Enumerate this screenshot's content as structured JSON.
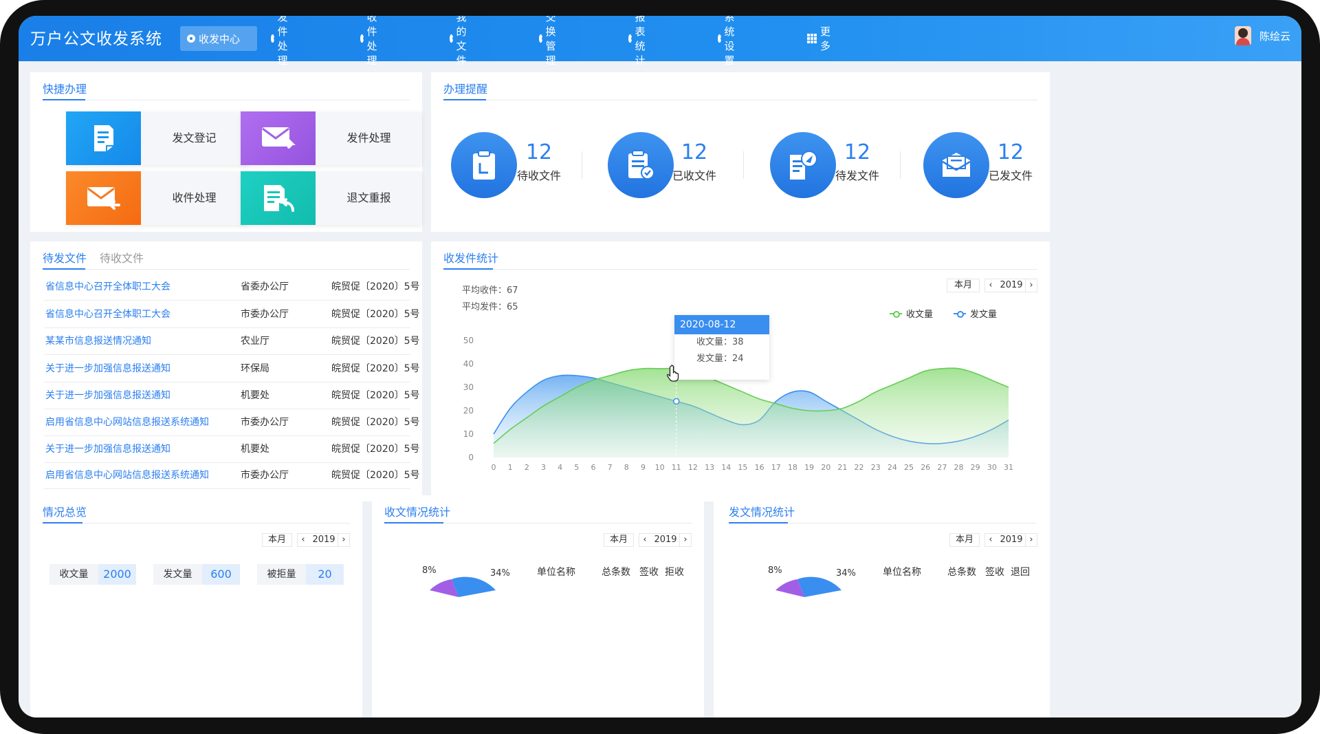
{
  "app": {
    "title": "万户公文收发系统"
  },
  "nav": {
    "items": [
      {
        "label": "收发中心"
      },
      {
        "label": "发件处理"
      },
      {
        "label": "收件处理"
      },
      {
        "label": "我的文件"
      },
      {
        "label": "交换管理"
      },
      {
        "label": "报表统计"
      },
      {
        "label": "系统设置"
      }
    ],
    "more": "更多",
    "active_index": 0
  },
  "user": {
    "name": "陈绘云"
  },
  "quick": {
    "title": "快捷办理",
    "items": [
      {
        "label": "发文登记",
        "color": "#1b96f0",
        "icon": "document-edit-icon"
      },
      {
        "label": "发件处理",
        "color": "#a25fe6",
        "icon": "mail-send-icon"
      },
      {
        "label": "收件处理",
        "color": "#f97a1d",
        "icon": "mail-receive-icon"
      },
      {
        "label": "退文重报",
        "color": "#17c5b7",
        "icon": "document-return-icon"
      }
    ]
  },
  "reminder": {
    "title": "办理提醒",
    "items": [
      {
        "count": "12",
        "label": "待收文件",
        "icon": "clipboard-icon"
      },
      {
        "count": "12",
        "label": "已收文件",
        "icon": "clipboard-check-icon"
      },
      {
        "count": "12",
        "label": "待发文件",
        "icon": "send-document-icon"
      },
      {
        "count": "12",
        "label": "已发文件",
        "icon": "envelope-icon"
      }
    ]
  },
  "files": {
    "tabs": [
      "待发文件",
      "待收文件"
    ],
    "active_tab": 0,
    "rows": [
      {
        "title": "省信息中心召开全体职工大会",
        "dept": "省委办公厅",
        "no": "皖贸促〔2020〕5号"
      },
      {
        "title": "省信息中心召开全体职工大会",
        "dept": "市委办公厅",
        "no": "皖贸促〔2020〕5号"
      },
      {
        "title": "某某市信息报送情况通知",
        "dept": "农业厅",
        "no": "皖贸促〔2020〕5号"
      },
      {
        "title": "关于进一步加强信息报送通知",
        "dept": "环保局",
        "no": "皖贸促〔2020〕5号"
      },
      {
        "title": "关于进一步加强信息报送通知",
        "dept": "机要处",
        "no": "皖贸促〔2020〕5号"
      },
      {
        "title": "启用省信息中心网站信息报送系统通知",
        "dept": "市委办公厅",
        "no": "皖贸促〔2020〕5号"
      },
      {
        "title": "关于进一步加强信息报送通知",
        "dept": "机要处",
        "no": "皖贸促〔2020〕5号"
      },
      {
        "title": "启用省信息中心网站信息报送系统通知",
        "dept": "市委办公厅",
        "no": "皖贸促〔2020〕5号"
      }
    ]
  },
  "stats": {
    "title": "收发件统计",
    "avg_recv": "平均收件：67",
    "avg_send": "平均发件：65",
    "period": "本月",
    "year": "2019",
    "prev": "‹",
    "next": "›",
    "tooltip": {
      "date": "2020-08-12",
      "recv": "收文量：38",
      "send": "发文量：24"
    }
  },
  "chart_data": {
    "type": "area",
    "x": [
      0,
      1,
      2,
      3,
      4,
      5,
      6,
      7,
      8,
      9,
      10,
      11,
      12,
      13,
      14,
      15,
      16,
      17,
      18,
      19,
      20,
      21,
      22,
      23,
      24,
      25,
      26,
      27,
      28,
      29,
      30,
      31
    ],
    "ylim": [
      0,
      50
    ],
    "yticks": [
      0,
      10,
      20,
      30,
      40,
      50
    ],
    "grid": false,
    "legend": "top-right",
    "series": [
      {
        "name": "收文量",
        "color": "#66cc55",
        "values": [
          6,
          12,
          17,
          22,
          26,
          30,
          33,
          35,
          37,
          38,
          38,
          38,
          37,
          34,
          31,
          28,
          25,
          23,
          21,
          20,
          20,
          21,
          24,
          28,
          31,
          34,
          37,
          38,
          38,
          36,
          33,
          30
        ]
      },
      {
        "name": "发文量",
        "color": "#3a8ef0",
        "values": [
          10,
          21,
          28,
          33,
          35,
          35,
          34,
          32,
          30,
          28,
          26,
          24,
          22,
          19,
          16,
          14,
          16,
          24,
          28,
          28,
          24,
          20,
          16,
          12,
          9,
          7,
          6,
          6,
          7,
          9,
          12,
          16
        ]
      }
    ]
  },
  "overview": {
    "title": "情况总览",
    "period": "本月",
    "year": "2019",
    "prev": "‹",
    "next": "›",
    "items": [
      {
        "label": "收文量",
        "value": "2000"
      },
      {
        "label": "发文量",
        "value": "600"
      },
      {
        "label": "被拒量",
        "value": "20"
      }
    ]
  },
  "recv_stats": {
    "title": "收文情况统计",
    "period": "本月",
    "year": "2019",
    "prev": "‹",
    "next": "›",
    "pct_left": "8%",
    "pct_right": "34%",
    "headers": [
      "单位名称",
      "总条数",
      "签收",
      "拒收"
    ]
  },
  "send_stats": {
    "title": "发文情况统计",
    "period": "本月",
    "year": "2019",
    "prev": "‹",
    "next": "›",
    "pct_left": "8%",
    "pct_right": "34%",
    "headers": [
      "单位名称",
      "总条数",
      "签收",
      "退回"
    ]
  }
}
